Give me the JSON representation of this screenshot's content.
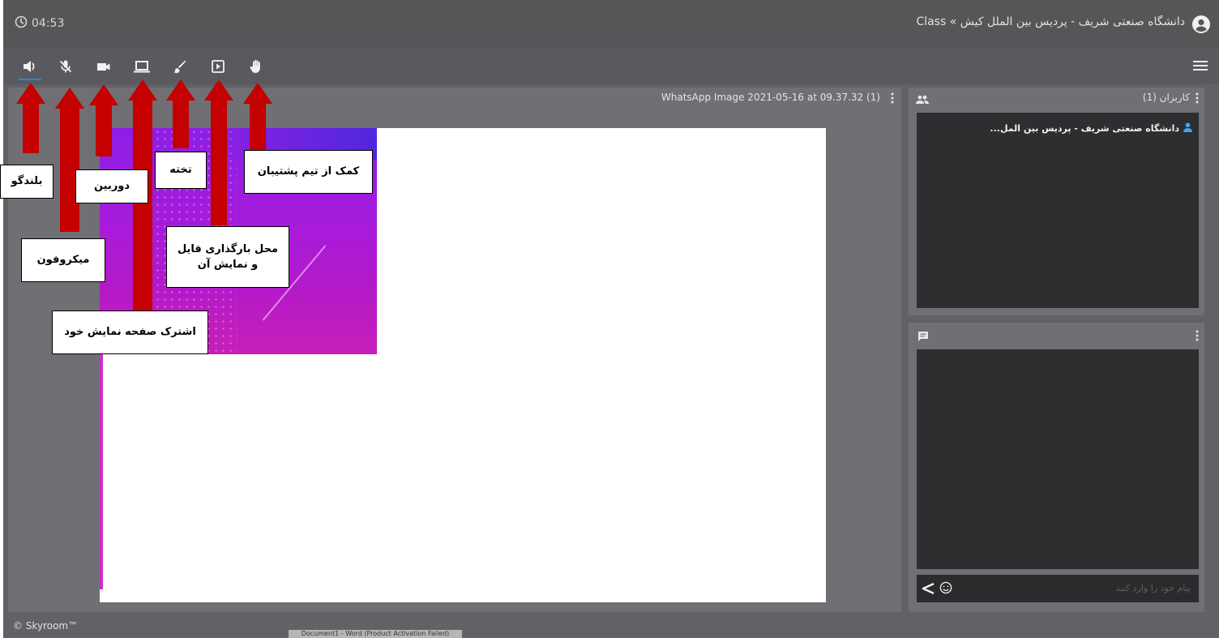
{
  "header": {
    "timer": "04:53",
    "class_title": "دانشگاه صنعتی شریف - پردیس بین الملل کیش » Class"
  },
  "toolbar": {
    "tools": [
      {
        "name": "speaker",
        "icon": "volume-icon",
        "active": true
      },
      {
        "name": "microphone",
        "icon": "mic-off-icon",
        "active": false
      },
      {
        "name": "camera",
        "icon": "video-camera-icon",
        "active": false
      },
      {
        "name": "share-screen",
        "icon": "laptop-icon",
        "active": false
      },
      {
        "name": "whiteboard",
        "icon": "brush-icon",
        "active": false
      },
      {
        "name": "presentation-file",
        "icon": "play-box-icon",
        "active": false
      },
      {
        "name": "raise-hand",
        "icon": "hand-icon",
        "active": false
      }
    ],
    "menu_icon": "hamburger-menu-icon",
    "accent_color": "#1e88e5"
  },
  "presentation": {
    "file_title": "WhatsApp Image 2021-05-16 at 09.37.32 (1)"
  },
  "users_panel": {
    "title": "کاربران (1)",
    "users": [
      "دانشگاه صنعتی شریف - پردیس بین المل..."
    ]
  },
  "chat_panel": {
    "input_placeholder": "پیام خود را وارد کنید"
  },
  "footer": {
    "copyright": "© Skyroom™",
    "taskbar_tooltip": "Document1 - Word (Product Activation Failed)"
  },
  "annotations": {
    "speaker": "بلندگو",
    "microphone": "میکروفون",
    "camera": "دوربین",
    "share_screen": "اشترک صفحه نمایش خود",
    "whiteboard": "تخته",
    "file_upload": "محل بارگذاری فایل و نمایش آن",
    "support": "کمک از تیم پشتیبان",
    "arrow_color": "#c40000"
  }
}
